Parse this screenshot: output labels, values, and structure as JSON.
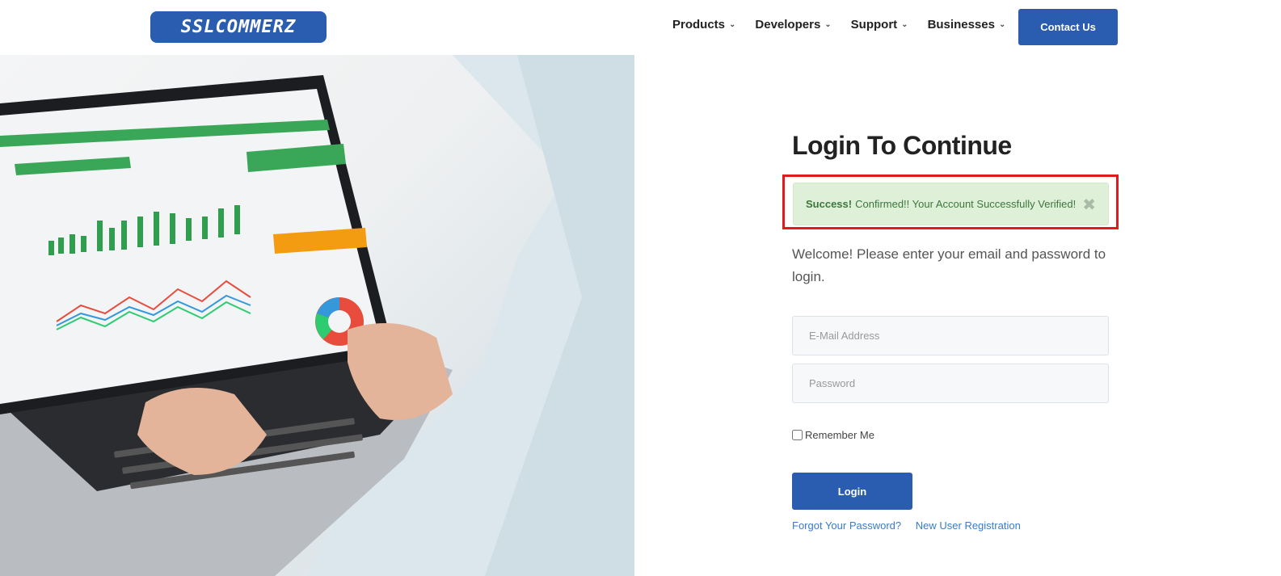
{
  "header": {
    "logo_text": "SSLCOMMERZ",
    "nav": [
      {
        "label": "Products"
      },
      {
        "label": "Developers"
      },
      {
        "label": "Support"
      },
      {
        "label": "Businesses"
      }
    ],
    "contact_label": "Contact Us"
  },
  "login": {
    "title": "Login To Continue",
    "alert_strong": "Success!",
    "alert_text": "Confirmed!! Your Account Successfully Verified!",
    "alert_close": "✖",
    "welcome": "Welcome! Please enter your email and password to login.",
    "email_placeholder": "E-Mail Address",
    "password_placeholder": "Password",
    "remember_label": "Remember Me",
    "login_label": "Login",
    "forgot_label": "Forgot Your Password?",
    "register_label": "New User Registration"
  },
  "colors": {
    "brand": "#2a5db0",
    "alert_bg": "#dff0d8",
    "alert_text": "#3c763d",
    "highlight": "#e11b1b",
    "link": "#3a7bc8"
  }
}
